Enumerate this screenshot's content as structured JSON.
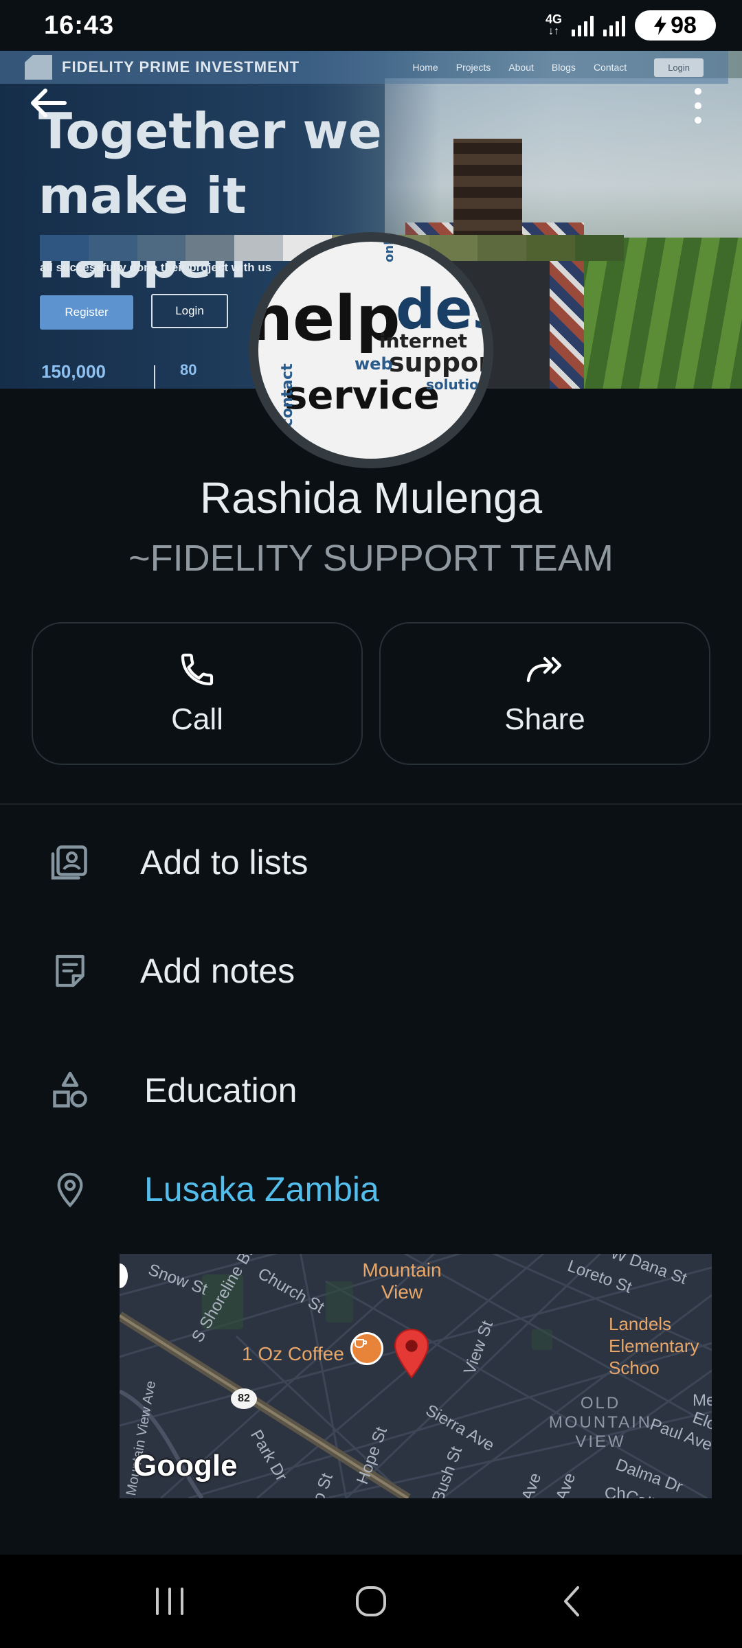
{
  "status_bar": {
    "time": "16:43",
    "network": "4G",
    "battery": "98"
  },
  "banner": {
    "brand": "FIDELITY PRIME INVESTMENT",
    "menu": [
      "Home",
      "Projects",
      "About",
      "Blogs",
      "Contact"
    ],
    "login_top": "Login",
    "headline_line1": "Together we",
    "headline_line2": "make it happen",
    "subtext": "all successfully done their project with us",
    "register": "Register",
    "login": "Login",
    "stat": "150,000",
    "stat2": "80"
  },
  "avatar_words": {
    "w1": "help",
    "w2": "desk",
    "w3": "internet",
    "w4": "support",
    "w5": "service",
    "w6": "web",
    "w7": "online",
    "w8": "contact",
    "w9": "solution"
  },
  "contact": {
    "name": "Rashida Mulenga",
    "subtitle": "~FIDELITY SUPPORT TEAM"
  },
  "actions": {
    "call": "Call",
    "share": "Share"
  },
  "rows": {
    "add_to_lists": "Add to lists",
    "add_notes": "Add notes",
    "education": "Education",
    "location": "Lusaka Zambia"
  },
  "map": {
    "area_title": "Mountain View",
    "poi": "1 Oz Coffee",
    "school": "Landels Elementary Schoo",
    "district": "OLD MOUNTAIN VIEW",
    "route": "82",
    "streets": [
      "Snow St",
      "Church St",
      "S Shoreline Blvd",
      "Mountain View Ave",
      "Park Dr",
      "Hope St",
      "View St",
      "Sierra Ave",
      "Bush St",
      "Loreto St",
      "W Dana St",
      "Paul Ave",
      "Dalma Dr",
      "Calif",
      "Elo",
      "Me",
      "Ave",
      "Ave",
      "Ch",
      "o St"
    ],
    "attribution": "Google"
  },
  "colors": {
    "background": "#0b1014",
    "link": "#53bdeb",
    "pin": "#e53935"
  }
}
